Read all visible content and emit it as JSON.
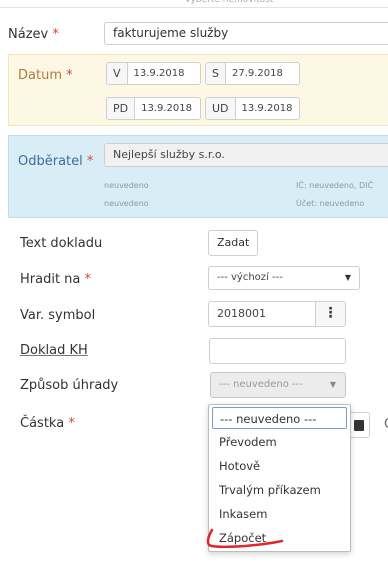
{
  "banner": {
    "text": "Vyberte nemovitost"
  },
  "form": {
    "nazev": {
      "label": "Název",
      "required_mark": "*",
      "value": "fakturujeme služby"
    },
    "datum": {
      "label": "Datum",
      "required_mark": "*",
      "fields": [
        {
          "prefix": "V",
          "value": "13.9.2018"
        },
        {
          "prefix": "S",
          "value": "27.9.2018"
        },
        {
          "prefix": "PD",
          "value": "13.9.2018"
        },
        {
          "prefix": "UD",
          "value": "13.9.2018"
        }
      ]
    },
    "odberatel": {
      "label": "Odběratel",
      "required_mark": "*",
      "value": "Nejlepší služby s.r.o.",
      "address_line1": "neuvedeno",
      "address_line2": "neuvedeno",
      "ic_text": "IČ: neuvedeno, DIČ",
      "ucet_text": "Účet: neuvedeno"
    },
    "text_dokladu": {
      "label": "Text dokladu",
      "button": "Zadat"
    },
    "hradit_na": {
      "label": "Hradit na",
      "required_mark": "*",
      "selected": "--- výchozí ---"
    },
    "var_symbol": {
      "label": "Var. symbol",
      "value": "2018001",
      "menu_icon": "kebab-icon"
    },
    "doklad_kh": {
      "label": "Doklad KH",
      "value": ""
    },
    "zpusob_uhrady": {
      "label": "Způsob úhrady",
      "selected": "--- neuvedeno ---",
      "options": [
        "--- neuvedeno ---",
        "Převodem",
        "Hotově",
        "Trvalým příkazem",
        "Inkasem",
        "Zápočet"
      ]
    },
    "castka": {
      "label": "Částka",
      "required_mark": "*",
      "edge_char": "C",
      "icon": "calculator-icon"
    }
  },
  "annotation": {
    "color": "#e0262b"
  },
  "colors": {
    "required": "#d9443e",
    "datum_panel": "#fcf8e3",
    "odberatel_panel": "#d9edf7"
  }
}
